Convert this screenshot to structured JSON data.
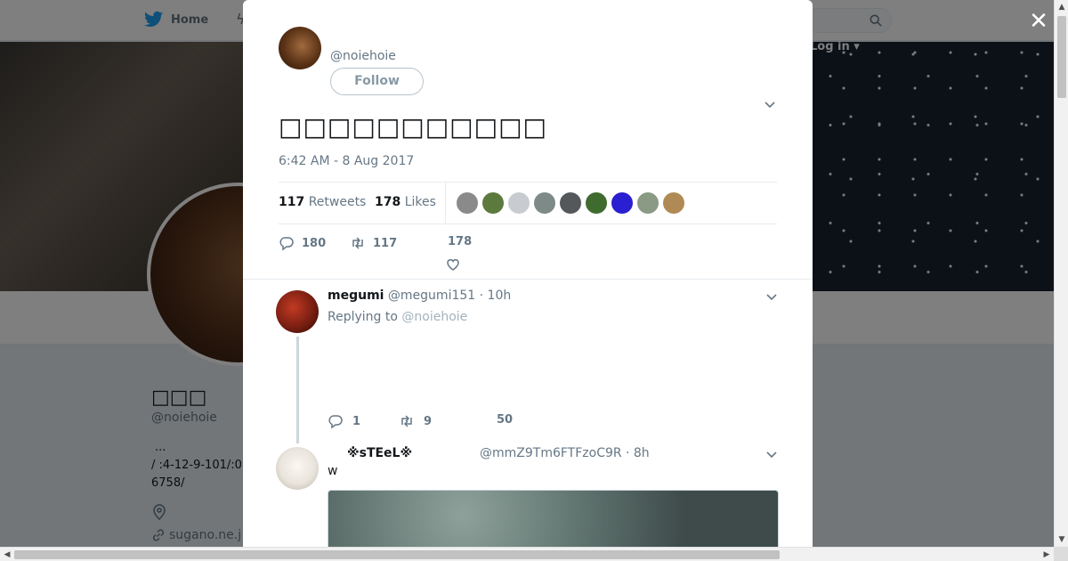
{
  "nav": {
    "home_label": "Home",
    "login_label": "Log in"
  },
  "profile": {
    "name": "□□□",
    "handle": "@noiehoie",
    "bio_line1": "...",
    "bio_line2": "/ :4-12-9-101/:0",
    "bio_line3": "6758/",
    "url": "sugano.ne.j"
  },
  "tweet": {
    "handle": "@noiehoie",
    "follow_label": "Follow",
    "text": "□□□□□□□□□□□",
    "timestamp": "6:42 AM - 8 Aug 2017",
    "retweets_count": "117",
    "retweets_label": "Retweets",
    "likes_count": "178",
    "likes_label": "Likes",
    "likers": [
      "#8a8a8a",
      "#5c7a3e",
      "#c8ccd0",
      "#7d8a87",
      "#55585a",
      "#3f6b2f",
      "#2a1fd1",
      "#8a9a84",
      "#b08a55"
    ],
    "reply_count": "180",
    "retweet_action_count": "117",
    "like_action_count": "178"
  },
  "replies": [
    {
      "name": "megumi",
      "handle": "@megumi151",
      "time": "· 10h",
      "replying_prefix": "Replying to",
      "replying_to": "@noiehoie",
      "reply_count": "1",
      "retweet_count": "9",
      "like_count": "50",
      "avatar_color": "#7a1f12"
    },
    {
      "name": "※sTEeL※",
      "handle": "@mmZ9Tm6FTFzoC9R",
      "time": "· 8h",
      "text": "w",
      "avatar_color": "#e9e4dc"
    }
  ]
}
